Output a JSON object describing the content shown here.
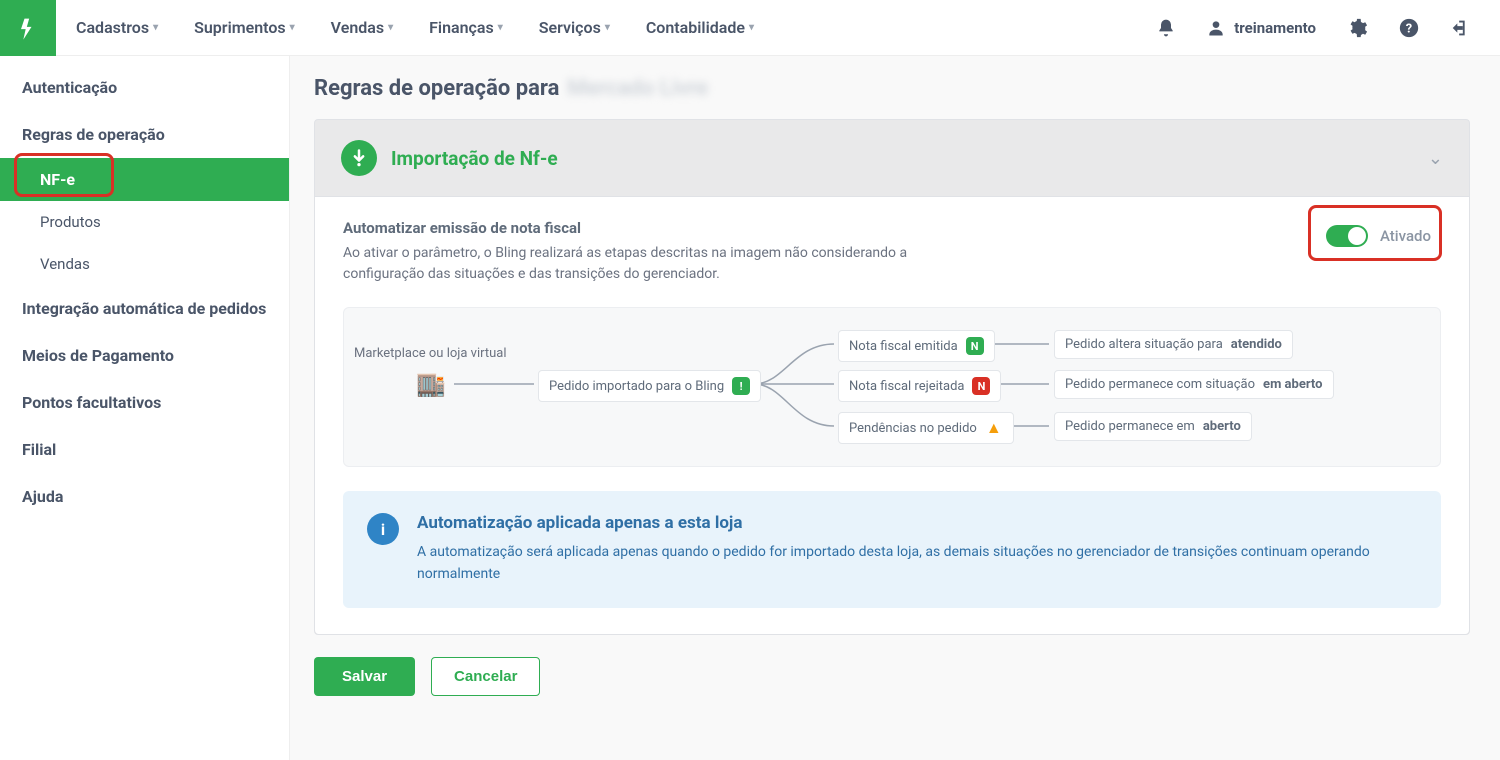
{
  "topnav": {
    "items": [
      "Cadastros",
      "Suprimentos",
      "Vendas",
      "Finanças",
      "Serviços",
      "Contabilidade"
    ]
  },
  "user": {
    "name": "treinamento"
  },
  "sidebar": {
    "items": [
      {
        "label": "Autenticação",
        "type": "item"
      },
      {
        "label": "Regras de operação",
        "type": "item"
      },
      {
        "label": "NF-e",
        "type": "active"
      },
      {
        "label": "Produtos",
        "type": "sub"
      },
      {
        "label": "Vendas",
        "type": "sub"
      },
      {
        "label": "Integração automática de pedidos",
        "type": "item"
      },
      {
        "label": "Meios de Pagamento",
        "type": "item"
      },
      {
        "label": "Pontos facultativos",
        "type": "item"
      },
      {
        "label": "Filial",
        "type": "item"
      },
      {
        "label": "Ajuda",
        "type": "item"
      }
    ]
  },
  "page": {
    "title_prefix": "Regras de operação para",
    "title_blur": "Mercado Livre"
  },
  "panel": {
    "title": "Importação de Nf-e",
    "setting_title": "Automatizar emissão de nota fiscal",
    "setting_desc": "Ao ativar o parâmetro, o Bling realizará as etapas descritas na imagem não considerando a configuração das situações e das transições do gerenciador.",
    "toggle_label": "Ativado"
  },
  "flow": {
    "source_label": "Marketplace ou loja virtual",
    "step_import": "Pedido importado para o Bling",
    "branch1": {
      "left": "Nota fiscal emitida",
      "right_pre": "Pedido altera situação para ",
      "right_bold": "atendido"
    },
    "branch2": {
      "left": "Nota fiscal rejeitada",
      "right_pre": "Pedido permanece com situação ",
      "right_bold": "em aberto"
    },
    "branch3": {
      "left": "Pendências no pedido",
      "right_pre": "Pedido permanece em ",
      "right_bold": "aberto"
    }
  },
  "info": {
    "title": "Automatização aplicada apenas a esta loja",
    "text": "A automatização será aplicada apenas quando o pedido for importado desta loja, as demais situações no gerenciador de transições continuam operando normalmente"
  },
  "footer": {
    "save": "Salvar",
    "cancel": "Cancelar"
  },
  "colors": {
    "accent": "#2fad52",
    "danger": "#d93025",
    "info": "#2f84c6"
  }
}
